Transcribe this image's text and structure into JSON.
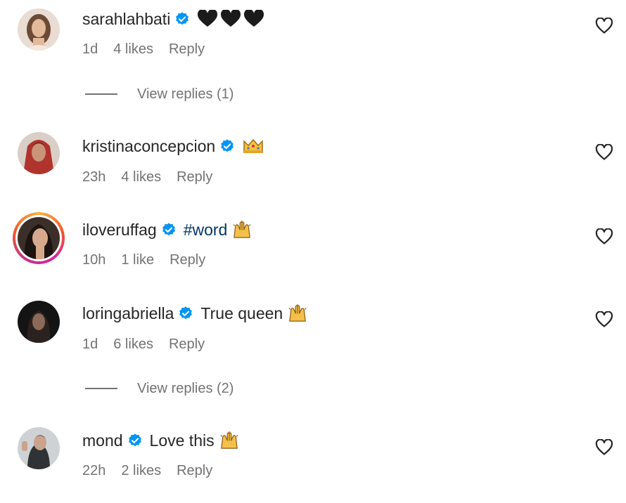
{
  "comments": [
    {
      "username": "sarahlahbati",
      "verified": true,
      "text": "",
      "emojis": [
        "black-heart",
        "black-heart",
        "black-heart"
      ],
      "time": "1d",
      "likes": "4 likes",
      "reply": "Reply",
      "view_replies": "View replies (1)"
    },
    {
      "username": "kristinaconcepcion",
      "verified": true,
      "text": "",
      "emojis": [
        "crown"
      ],
      "time": "23h",
      "likes": "4 likes",
      "reply": "Reply"
    },
    {
      "username": "iloveruffag",
      "verified": true,
      "hashtag": "#word",
      "emojis": [
        "raising-hands"
      ],
      "time": "10h",
      "likes": "1 like",
      "reply": "Reply"
    },
    {
      "username": "loringabriella",
      "verified": true,
      "text": "True queen",
      "emojis": [
        "raising-hands"
      ],
      "time": "1d",
      "likes": "6 likes",
      "reply": "Reply",
      "view_replies": "View replies (2)"
    },
    {
      "username": "mond",
      "verified": true,
      "text": "Love this",
      "emojis": [
        "raising-hands"
      ],
      "time": "22h",
      "likes": "2 likes",
      "reply": "Reply"
    }
  ],
  "colors": {
    "text": "#262626",
    "meta": "#737373",
    "verified": "#0095f6",
    "hashtag": "#00376b"
  }
}
